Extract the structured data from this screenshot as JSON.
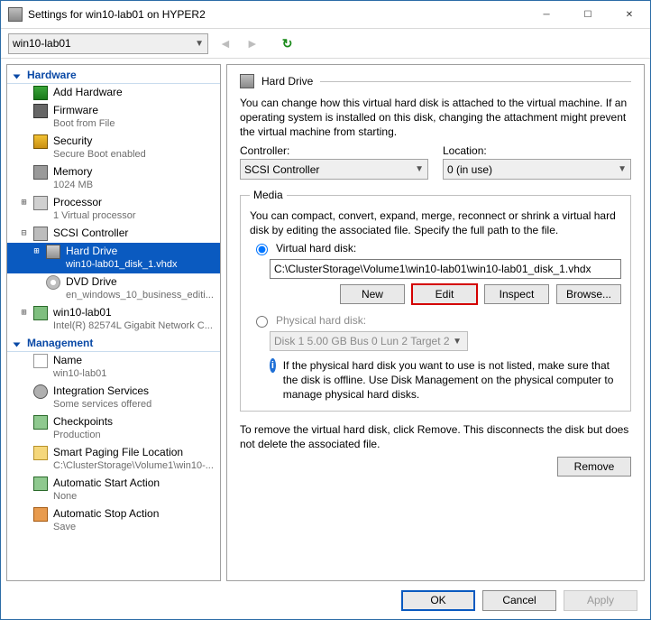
{
  "window": {
    "title": "Settings for win10-lab01 on HYPER2"
  },
  "toolbar": {
    "vm_name": "win10-lab01"
  },
  "tree": {
    "hardware_header": "Hardware",
    "management_header": "Management",
    "items": {
      "add_hw": "Add Hardware",
      "firmware": "Firmware",
      "firmware_sub": "Boot from File",
      "security": "Security",
      "security_sub": "Secure Boot enabled",
      "memory": "Memory",
      "memory_sub": "1024 MB",
      "processor": "Processor",
      "processor_sub": "1 Virtual processor",
      "scsi": "SCSI Controller",
      "hard_drive": "Hard Drive",
      "hard_drive_sub": "win10-lab01_disk_1.vhdx",
      "dvd": "DVD Drive",
      "dvd_sub": "en_windows_10_business_editi...",
      "nic": "win10-lab01",
      "nic_sub": "Intel(R) 82574L Gigabit Network C...",
      "name": "Name",
      "name_sub": "win10-lab01",
      "integ": "Integration Services",
      "integ_sub": "Some services offered",
      "check": "Checkpoints",
      "check_sub": "Production",
      "spf": "Smart Paging File Location",
      "spf_sub": "C:\\ClusterStorage\\Volume1\\win10-...",
      "asa": "Automatic Start Action",
      "asa_sub": "None",
      "asto": "Automatic Stop Action",
      "asto_sub": "Save"
    }
  },
  "content": {
    "header": "Hard Drive",
    "intro": "You can change how this virtual hard disk is attached to the virtual machine. If an operating system is installed on this disk, changing the attachment might prevent the virtual machine from starting.",
    "controller_label": "Controller:",
    "controller_value": "SCSI Controller",
    "location_label": "Location:",
    "location_value": "0 (in use)",
    "media_legend": "Media",
    "media_intro": "You can compact, convert, expand, merge, reconnect or shrink a virtual hard disk by editing the associated file. Specify the full path to the file.",
    "vhd_radio": "Virtual hard disk:",
    "vhd_path": "C:\\ClusterStorage\\Volume1\\win10-lab01\\win10-lab01_disk_1.vhdx",
    "btn_new": "New",
    "btn_edit": "Edit",
    "btn_inspect": "Inspect",
    "btn_browse": "Browse...",
    "phd_radio": "Physical hard disk:",
    "phd_value": "Disk 1 5.00 GB Bus 0 Lun 2 Target 2",
    "phd_info": "If the physical hard disk you want to use is not listed, make sure that the disk is offline. Use Disk Management on the physical computer to manage physical hard disks.",
    "remove_intro": "To remove the virtual hard disk, click Remove. This disconnects the disk but does not delete the associated file.",
    "btn_remove": "Remove"
  },
  "footer": {
    "ok": "OK",
    "cancel": "Cancel",
    "apply": "Apply"
  }
}
